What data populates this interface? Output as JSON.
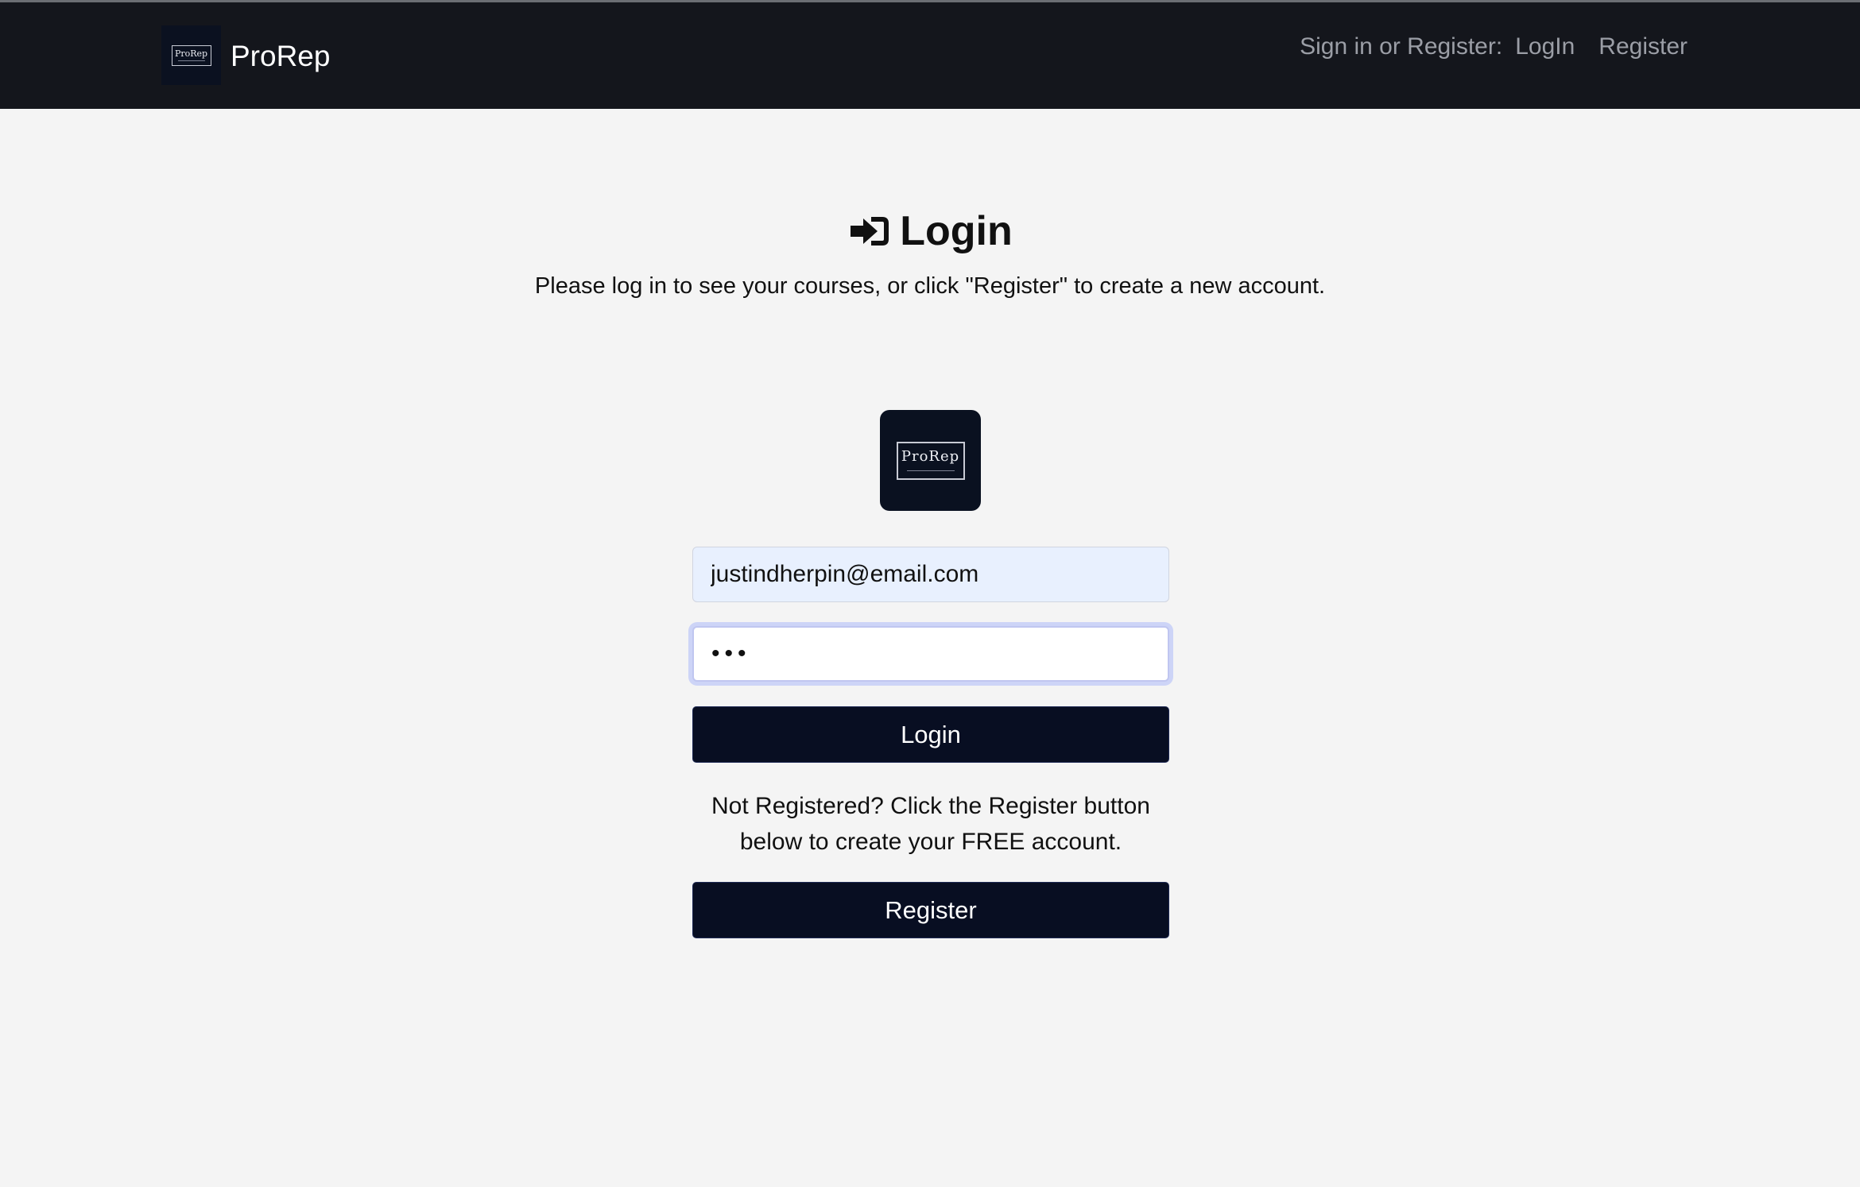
{
  "navbar": {
    "brand_logo_text": "ProRep",
    "brand_name": "ProRep",
    "auth_prompt": "Sign in or Register:",
    "login_link": "LogIn",
    "register_link": "Register",
    "background_color": "#14161c"
  },
  "main": {
    "title": "Login",
    "title_icon": "sign-in-icon",
    "subtitle": "Please log in to see your courses, or click \"Register\" to create a new account.",
    "logo_text": "ProRep",
    "email": {
      "value": "justindherpin@email.com"
    },
    "password": {
      "value": "•••"
    },
    "login_button": "Login",
    "register_note": "Not Registered? Click the Register button below to create your FREE account.",
    "register_button": "Register",
    "button_color": "#080e22"
  }
}
